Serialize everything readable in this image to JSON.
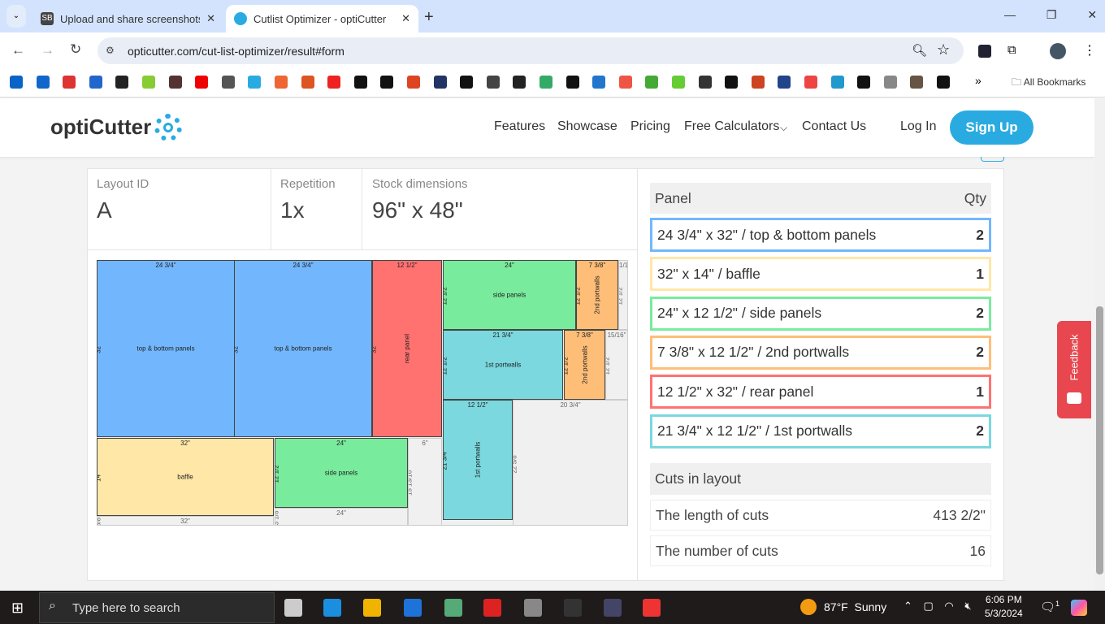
{
  "browser": {
    "tabs": [
      {
        "title": "Upload and share screenshots a",
        "favicon": "SB"
      },
      {
        "title": "Cutlist Optimizer - optiCutter",
        "favicon": "gear-icon"
      }
    ],
    "url": "opticutter.com/cut-list-optimizer/result#form",
    "all_bookmarks": "All Bookmarks"
  },
  "site": {
    "logo": "optiCutter",
    "nav": [
      "Features",
      "Showcase",
      "Pricing",
      "Free Calculators",
      "Contact Us"
    ],
    "login": "Log In",
    "signup": "Sign Up",
    "feedback": "Feedback",
    "accent": "#29abe2"
  },
  "layout": {
    "id_label": "Layout ID",
    "id": "A",
    "rep_label": "Repetition",
    "rep": "1x",
    "stock_label": "Stock dimensions",
    "stock": "96\" x 48\"",
    "pieces": [
      {
        "name": "top & bottom panels",
        "w": "24 3/4\"",
        "h": "32\"",
        "color": "#72b7fd"
      },
      {
        "name": "top & bottom panels",
        "w": "24 3/4\"",
        "h": "32\"",
        "color": "#72b7fd"
      },
      {
        "name": "rear panel",
        "w": "12 1/2\"",
        "h": "32\"",
        "color": "#ff7270"
      },
      {
        "name": "side panels",
        "w": "24\"",
        "h": "12 1/2\"",
        "color": "#79eb9d"
      },
      {
        "name": "2nd portwalls",
        "w": "7 3/8\"",
        "h": "12 1/2\"",
        "color": "#ffbe78"
      },
      {
        "name": "1st portwalls",
        "w": "21 3/4\"",
        "h": "12 1/2\"",
        "color": "#7ad8de"
      },
      {
        "name": "2nd portwalls",
        "w": "7 3/8\"",
        "h": "12 1/2\"",
        "color": "#ffbe78"
      },
      {
        "name": "1st portwalls",
        "w": "12 1/2\"",
        "h": "21 3/4\"",
        "color": "#7ad8de"
      },
      {
        "name": "baffle",
        "w": "32\"",
        "h": "14\"",
        "color": "#ffe7a8"
      },
      {
        "name": "side panels",
        "w": "24\"",
        "h": "12 1/2\"",
        "color": "#79eb9d"
      }
    ],
    "waste": [
      {
        "w": "1/16\"",
        "h": "12 1/2\""
      },
      {
        "w": "15/16\"",
        "h": "12 1/2\""
      },
      {
        "w": "20 3/4\"",
        "h": "22 5/8\""
      },
      {
        "w": "6\"",
        "h": "15 13/16\""
      },
      {
        "w": "32\"",
        "h": "5/8\""
      },
      {
        "w": "24\"",
        "h": "3 1/8\""
      }
    ]
  },
  "panels": {
    "header": "Panel",
    "qty_header": "Qty",
    "rows": [
      {
        "label": "24 3/4\" x 32\" / top & bottom panels",
        "qty": "2",
        "color": "#72b7fd"
      },
      {
        "label": "32\" x 14\" / baffle",
        "qty": "1",
        "color": "#ffe7a8"
      },
      {
        "label": "24\" x 12 1/2\" / side panels",
        "qty": "2",
        "color": "#79eb9d"
      },
      {
        "label": "7 3/8\" x 12 1/2\" / 2nd portwalls",
        "qty": "2",
        "color": "#ffbe78"
      },
      {
        "label": "12 1/2\" x 32\" / rear panel",
        "qty": "1",
        "color": "#ff7270"
      },
      {
        "label": "21 3/4\" x 12 1/2\" / 1st portwalls",
        "qty": "2",
        "color": "#7ad8de"
      }
    ],
    "cuts_header": "Cuts in layout",
    "length_label": "The length of cuts",
    "length": "413 2/2\"",
    "number_label": "The number of cuts",
    "number": "16"
  },
  "taskbar": {
    "search": "Type here to search",
    "temp": "87°F",
    "weather": "Sunny",
    "time": "6:06 PM",
    "date": "5/3/2024",
    "notif": "1"
  }
}
